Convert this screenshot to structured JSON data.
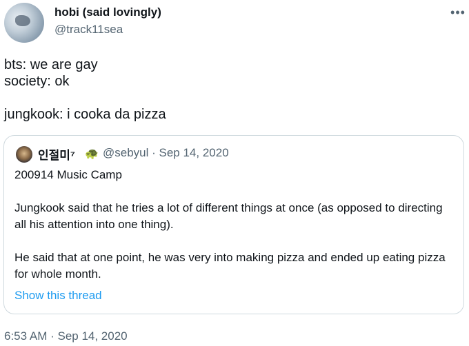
{
  "author": {
    "display_name": "hobi (said lovingly)",
    "handle": "@track11sea"
  },
  "more_icon": "more-horizontal-icon",
  "tweet": {
    "text": "bts: we are gay\nsociety: ok\n\njungkook: i cooka da pizza",
    "timestamp": "6:53 AM · Sep 14, 2020"
  },
  "quote": {
    "display_name": "인절미⁷",
    "badge_emoji": "🐢",
    "handle_time": "@sebyul · Sep 14, 2020",
    "text": "200914 Music Camp\n\nJungkook said that he tries a lot of different things at once (as opposed to directing all his attention into one thing).\n\nHe said that at one point, he was very into making pizza and ended up eating pizza for whole month.",
    "show_thread": "Show this thread"
  },
  "colors": {
    "text_primary": "#0f1419",
    "text_secondary": "#536471",
    "link": "#1d9bf0",
    "border": "#cfd9de"
  }
}
